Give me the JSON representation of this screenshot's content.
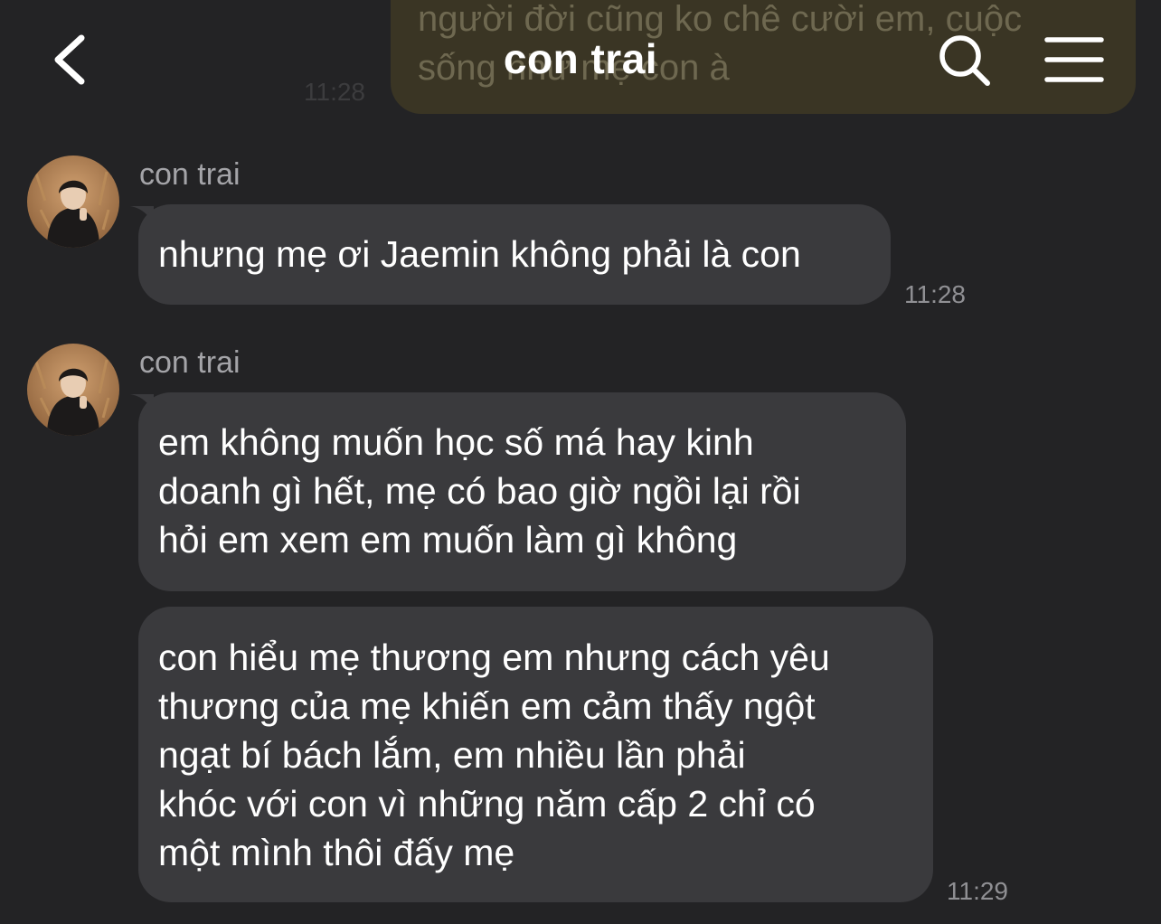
{
  "header": {
    "title": "con trai",
    "back_icon": "chevron-left-icon",
    "search_icon": "search-icon",
    "menu_icon": "hamburger-menu-icon"
  },
  "previous_outgoing": {
    "lines": [
      "người đời cũng ko chê cười em, cuộc",
      "sống như mẹ con à"
    ],
    "time": "11:28"
  },
  "groups": [
    {
      "sender": "con trai",
      "messages": [
        {
          "lines": [
            "nhưng mẹ ơi Jaemin không phải là con"
          ],
          "time": "11:28"
        }
      ]
    },
    {
      "sender": "con trai",
      "messages": [
        {
          "lines": [
            "em không muốn học số má hay kinh",
            "doanh gì hết, mẹ có bao giờ ngồi lại rồi",
            "hỏi em xem em muốn làm gì không"
          ]
        },
        {
          "lines": [
            "con hiểu mẹ thương em nhưng cách yêu",
            "thương của mẹ khiến em cảm thấy ngột",
            "ngạt bí bách lắm, em nhiều lần phải",
            "khóc với con vì những năm cấp 2 chỉ có",
            "một mình thôi đấy mẹ"
          ],
          "time": "11:29"
        }
      ]
    }
  ],
  "colors": {
    "background": "#232325",
    "incoming_bubble": "#3a3a3d",
    "outgoing_bubble": "#3a3524",
    "timestamp": "#909094",
    "sender_name": "#a4a4a8"
  }
}
